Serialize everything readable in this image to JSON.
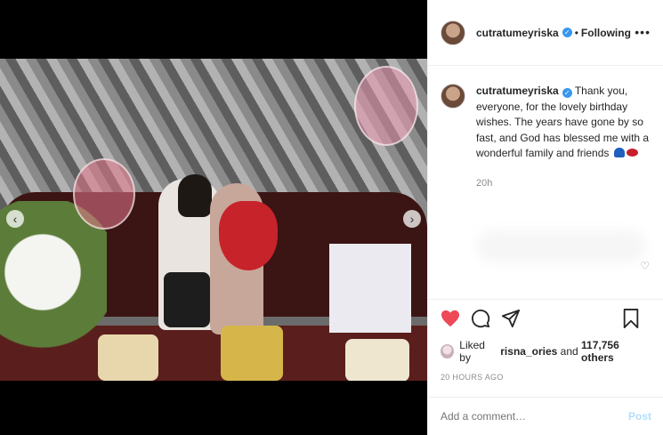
{
  "header": {
    "username": "cutratumeyriska",
    "separator": "•",
    "follow_status": "Following",
    "more": "•••"
  },
  "caption": {
    "username": "cutratumeyriska",
    "text": "Thank you, everyone, for the lovely birthday wishes. The years have gone by so fast, and God has blessed me with a wonderful family and friends",
    "time": "20h"
  },
  "likes": {
    "prefix": "Liked by",
    "user": "risna_ories",
    "connector": "and",
    "count": "117,756 others"
  },
  "timestamp": "20 HOURS AGO",
  "comment": {
    "placeholder": "Add a comment…",
    "post_label": "Post"
  },
  "colors": {
    "verified": "#3897f0",
    "like_active": "#ed4956",
    "post_disabled": "#b2dffc"
  },
  "icons": [
    "chevron-left-icon",
    "chevron-right-icon",
    "verified-badge-icon",
    "more-options-icon",
    "heart-icon",
    "comment-icon",
    "share-icon",
    "bookmark-icon"
  ]
}
